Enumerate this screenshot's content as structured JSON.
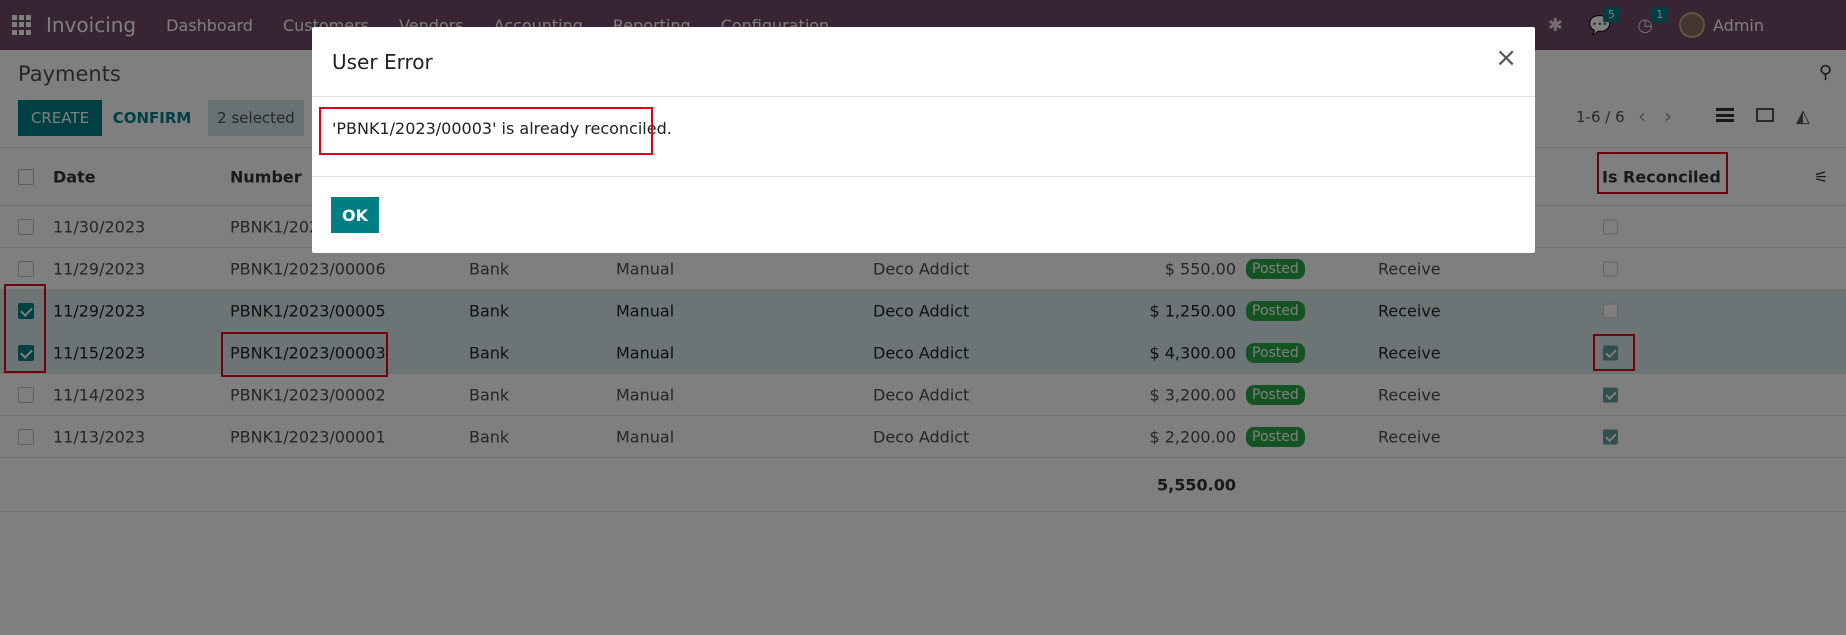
{
  "navbar": {
    "app_name": "Invoicing",
    "menu": [
      "Dashboard",
      "Customers",
      "Vendors",
      "Accounting",
      "Reporting",
      "Configuration"
    ],
    "messages_count": "5",
    "activities_count": "1",
    "user_name": "Admin"
  },
  "control_panel": {
    "breadcrumb": "Payments",
    "create_label": "CREATE",
    "confirm_label": "CONFIRM",
    "selected_label": "2 selected",
    "pager": "1-6 / 6"
  },
  "table": {
    "headers": {
      "date": "Date",
      "number": "Number",
      "is_reconciled": "Is Reconciled"
    },
    "rows": [
      {
        "date": "11/30/2023",
        "number": "PBNK1/202",
        "journal": "",
        "method": "",
        "partner": "",
        "amount": "",
        "status": "",
        "type": "",
        "selected": false,
        "reconciled": false
      },
      {
        "date": "11/29/2023",
        "number": "PBNK1/2023/00006",
        "journal": "Bank",
        "method": "Manual",
        "partner": "Deco Addict",
        "amount": "$ 550.00",
        "status": "Posted",
        "type": "Receive",
        "selected": false,
        "reconciled": false
      },
      {
        "date": "11/29/2023",
        "number": "PBNK1/2023/00005",
        "journal": "Bank",
        "method": "Manual",
        "partner": "Deco Addict",
        "amount": "$ 1,250.00",
        "status": "Posted",
        "type": "Receive",
        "selected": true,
        "reconciled": false
      },
      {
        "date": "11/15/2023",
        "number": "PBNK1/2023/00003",
        "journal": "Bank",
        "method": "Manual",
        "partner": "Deco Addict",
        "amount": "$ 4,300.00",
        "status": "Posted",
        "type": "Receive",
        "selected": true,
        "reconciled": true
      },
      {
        "date": "11/14/2023",
        "number": "PBNK1/2023/00002",
        "journal": "Bank",
        "method": "Manual",
        "partner": "Deco Addict",
        "amount": "$ 3,200.00",
        "status": "Posted",
        "type": "Receive",
        "selected": false,
        "reconciled": true
      },
      {
        "date": "11/13/2023",
        "number": "PBNK1/2023/00001",
        "journal": "Bank",
        "method": "Manual",
        "partner": "Deco Addict",
        "amount": "$ 2,200.00",
        "status": "Posted",
        "type": "Receive",
        "selected": false,
        "reconciled": true
      }
    ],
    "total": "5,550.00"
  },
  "dialog": {
    "title": "User Error",
    "message": "'PBNK1/2023/00003' is already reconciled.",
    "ok_label": "OK",
    "close_glyph": "×"
  },
  "colors": {
    "navbar": "#714b67",
    "primary": "#017e84",
    "posted": "#28a745",
    "annotation": "#e0001a"
  }
}
